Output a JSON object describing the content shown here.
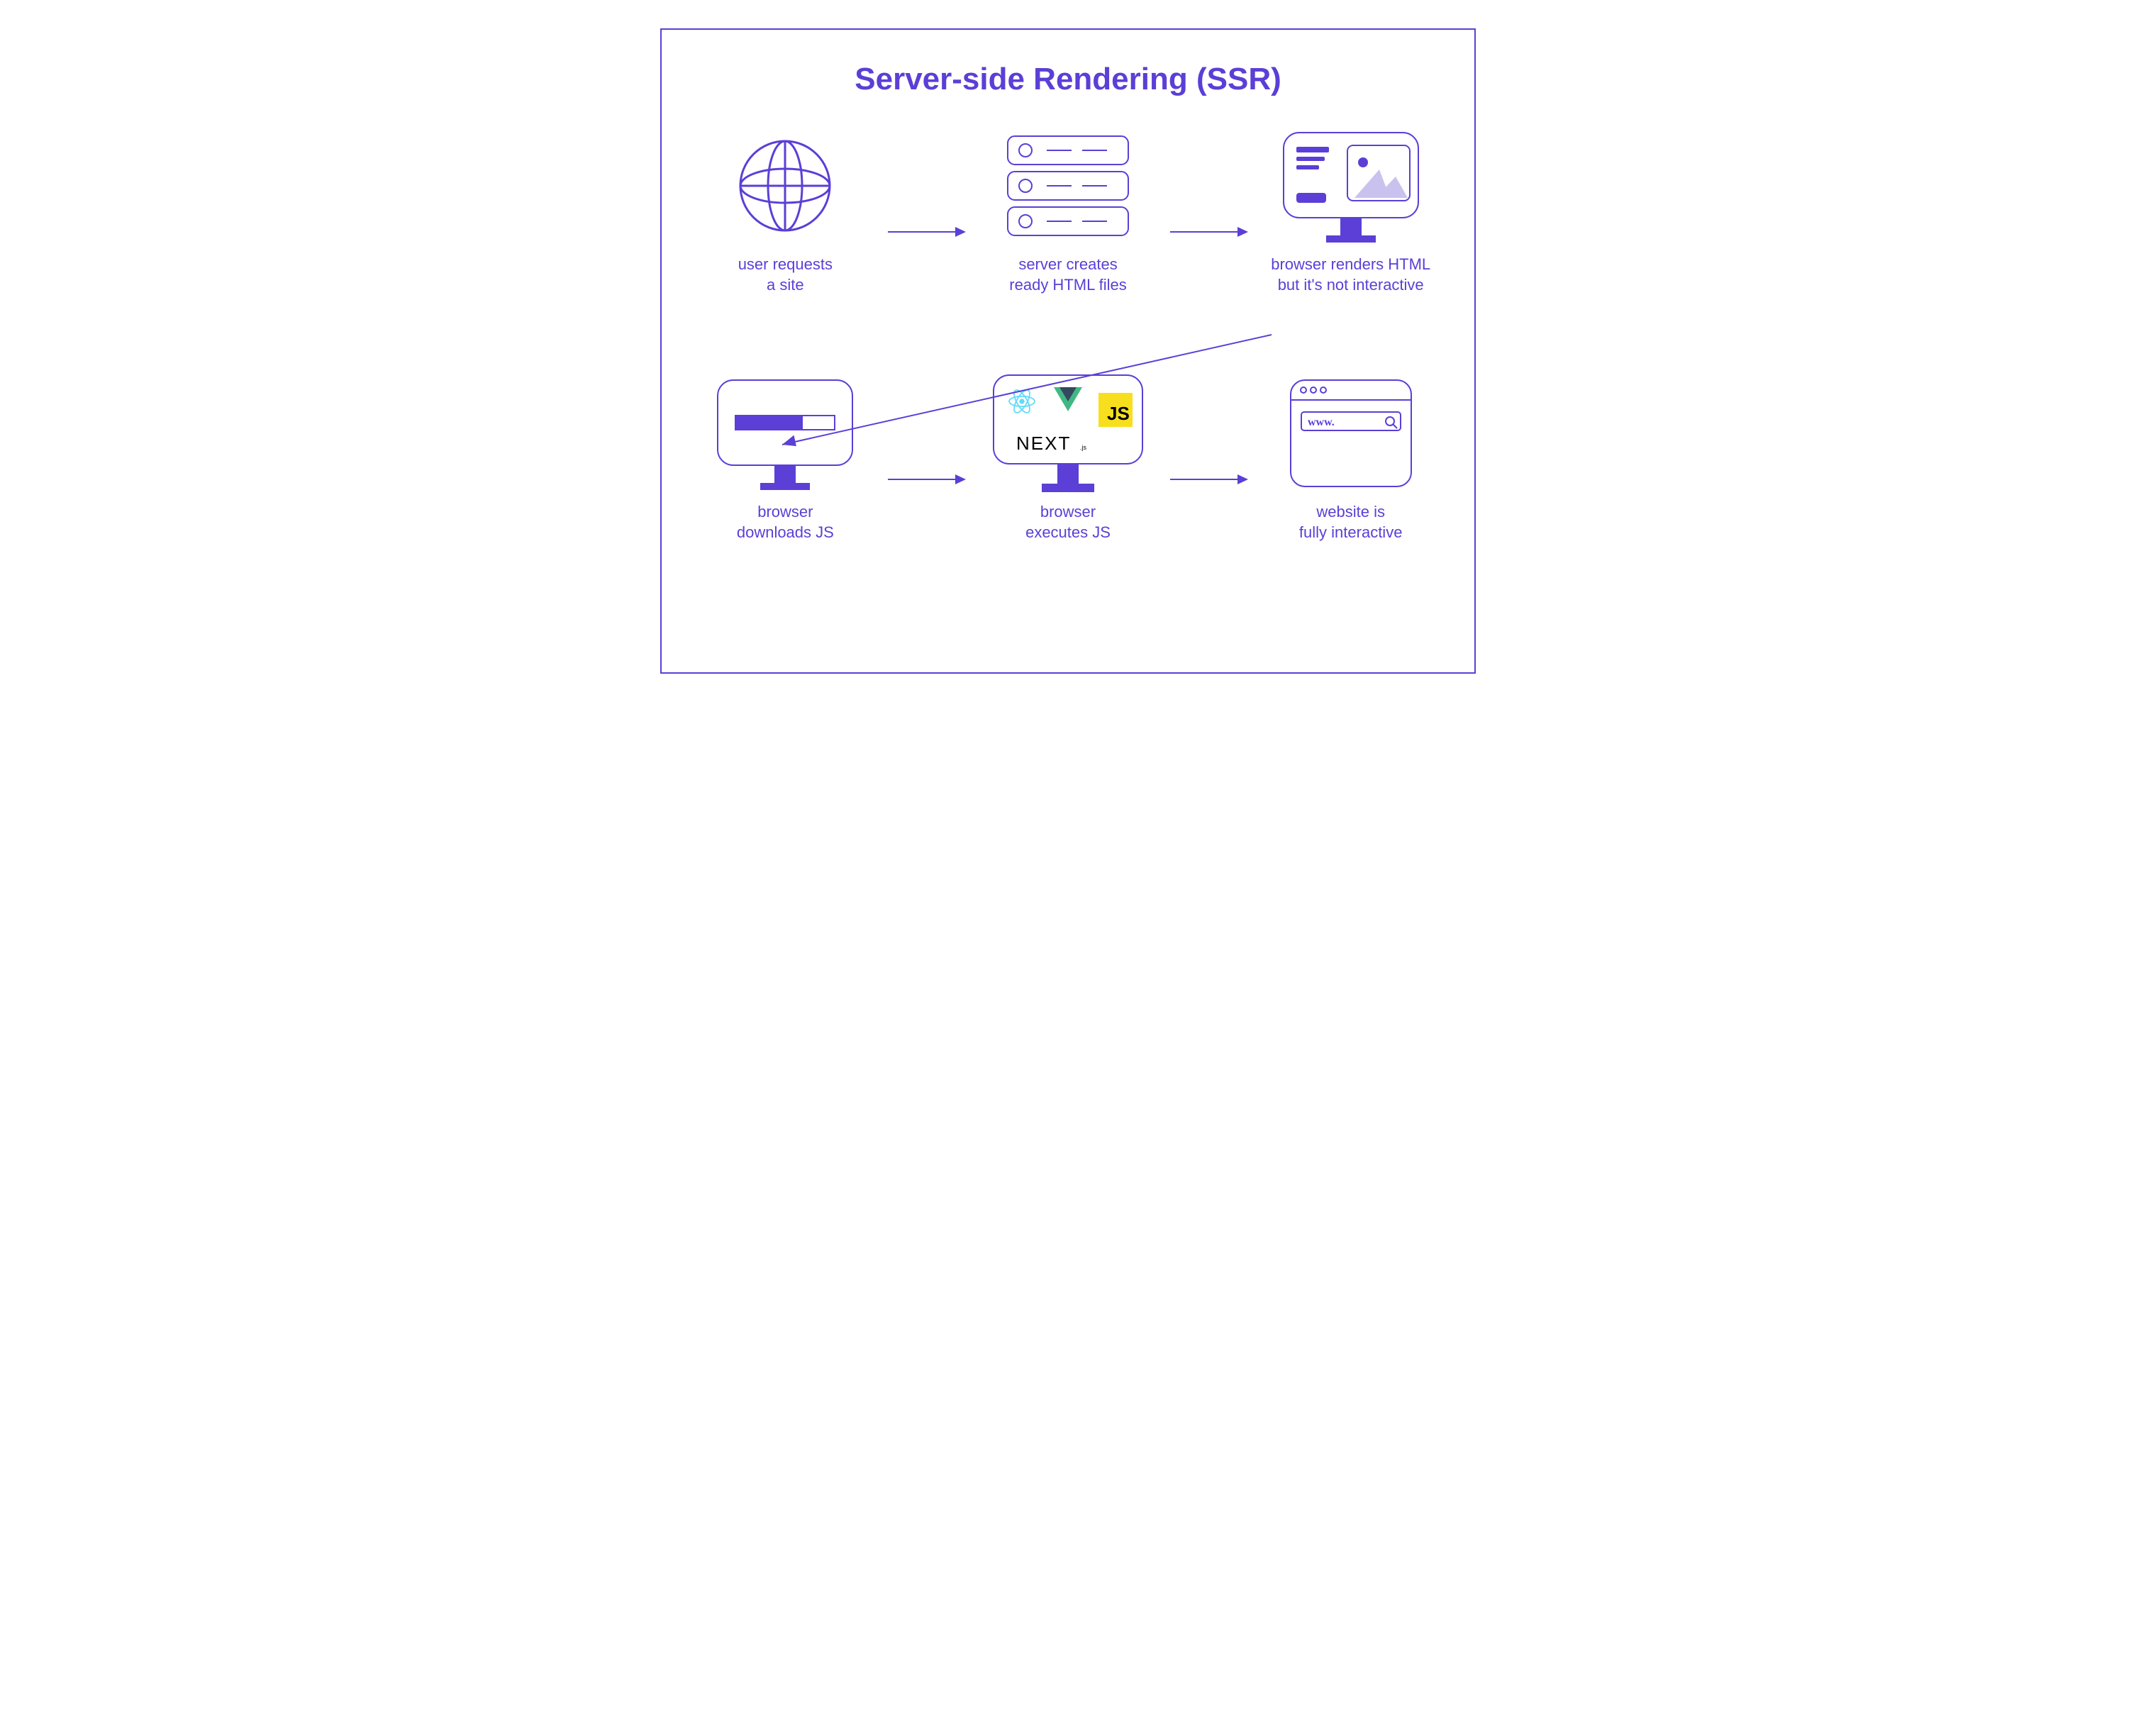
{
  "title": "Server-side Rendering (SSR)",
  "colors": {
    "outline": "#5b3fd6",
    "fill": "#5b3fd6",
    "light": "#c9c2ef",
    "react": "#61dafb",
    "vue_dark": "#35495e",
    "vue_green": "#41b883",
    "js_bg": "#f7df1e",
    "js_text": "#000000"
  },
  "steps": [
    {
      "id": "user-request",
      "caption": "user requests\na site",
      "icon": "globe"
    },
    {
      "id": "server-creates",
      "caption": "server creates\nready HTML files",
      "icon": "server"
    },
    {
      "id": "browser-renders",
      "caption": "browser renders HTML\nbut it's not interactive",
      "icon": "monitor-page"
    },
    {
      "id": "browser-downloads",
      "caption": "browser\ndownloads JS",
      "icon": "monitor-progress"
    },
    {
      "id": "browser-executes",
      "caption": "browser\nexecutes JS",
      "icon": "monitor-frameworks",
      "logos": [
        "react",
        "vue",
        "js",
        "next"
      ]
    },
    {
      "id": "fully-interactive",
      "caption": "website is\nfully interactive",
      "icon": "browser-window",
      "url_text": "www."
    }
  ],
  "js_label": "JS",
  "next_label": "NEXT",
  "next_suffix": ".js"
}
